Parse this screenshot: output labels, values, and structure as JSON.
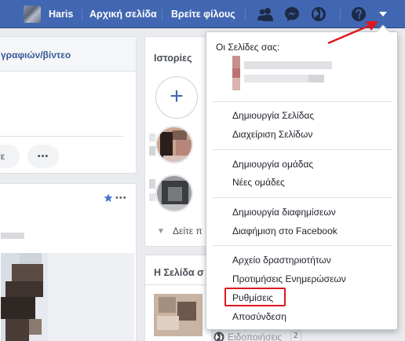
{
  "topbar": {
    "user_name": "Haris",
    "home_label": "Αρχική σελίδα",
    "find_friends_label": "Βρείτε φίλους",
    "icons": [
      "friends-icon",
      "messenger-icon",
      "globe-icon",
      "help-icon",
      "dropdown-caret-icon"
    ]
  },
  "left": {
    "photo_video_tab": "γραφιών/βίντεο",
    "button_partial": "τε",
    "more_label": "•••"
  },
  "stories": {
    "title": "Ιστορίες",
    "add_symbol": "+",
    "see_more": "Δείτε π"
  },
  "pages_panel": {
    "title": "Η Σελίδα σ",
    "notifications_label": "Ειδοποιήσεις",
    "notifications_count": "2"
  },
  "dropdown": {
    "header": "Οι Σελίδες σας:",
    "items": [
      "Δημιουργία Σελίδας",
      "Διαχείριση Σελίδων",
      "Δημιουργία ομάδας",
      "Νέες ομάδες",
      "Δημιουργία διαφημίσεων",
      "Διαφήμιση στο Facebook",
      "Αρχείο δραστηριοτήτων",
      "Προτιμήσεις Ενημερώσεων",
      "Ρυθμίσεις",
      "Αποσύνδεση"
    ]
  },
  "colors": {
    "topbar": "#4267b2",
    "link": "#365899",
    "highlight": "#e0161e"
  }
}
